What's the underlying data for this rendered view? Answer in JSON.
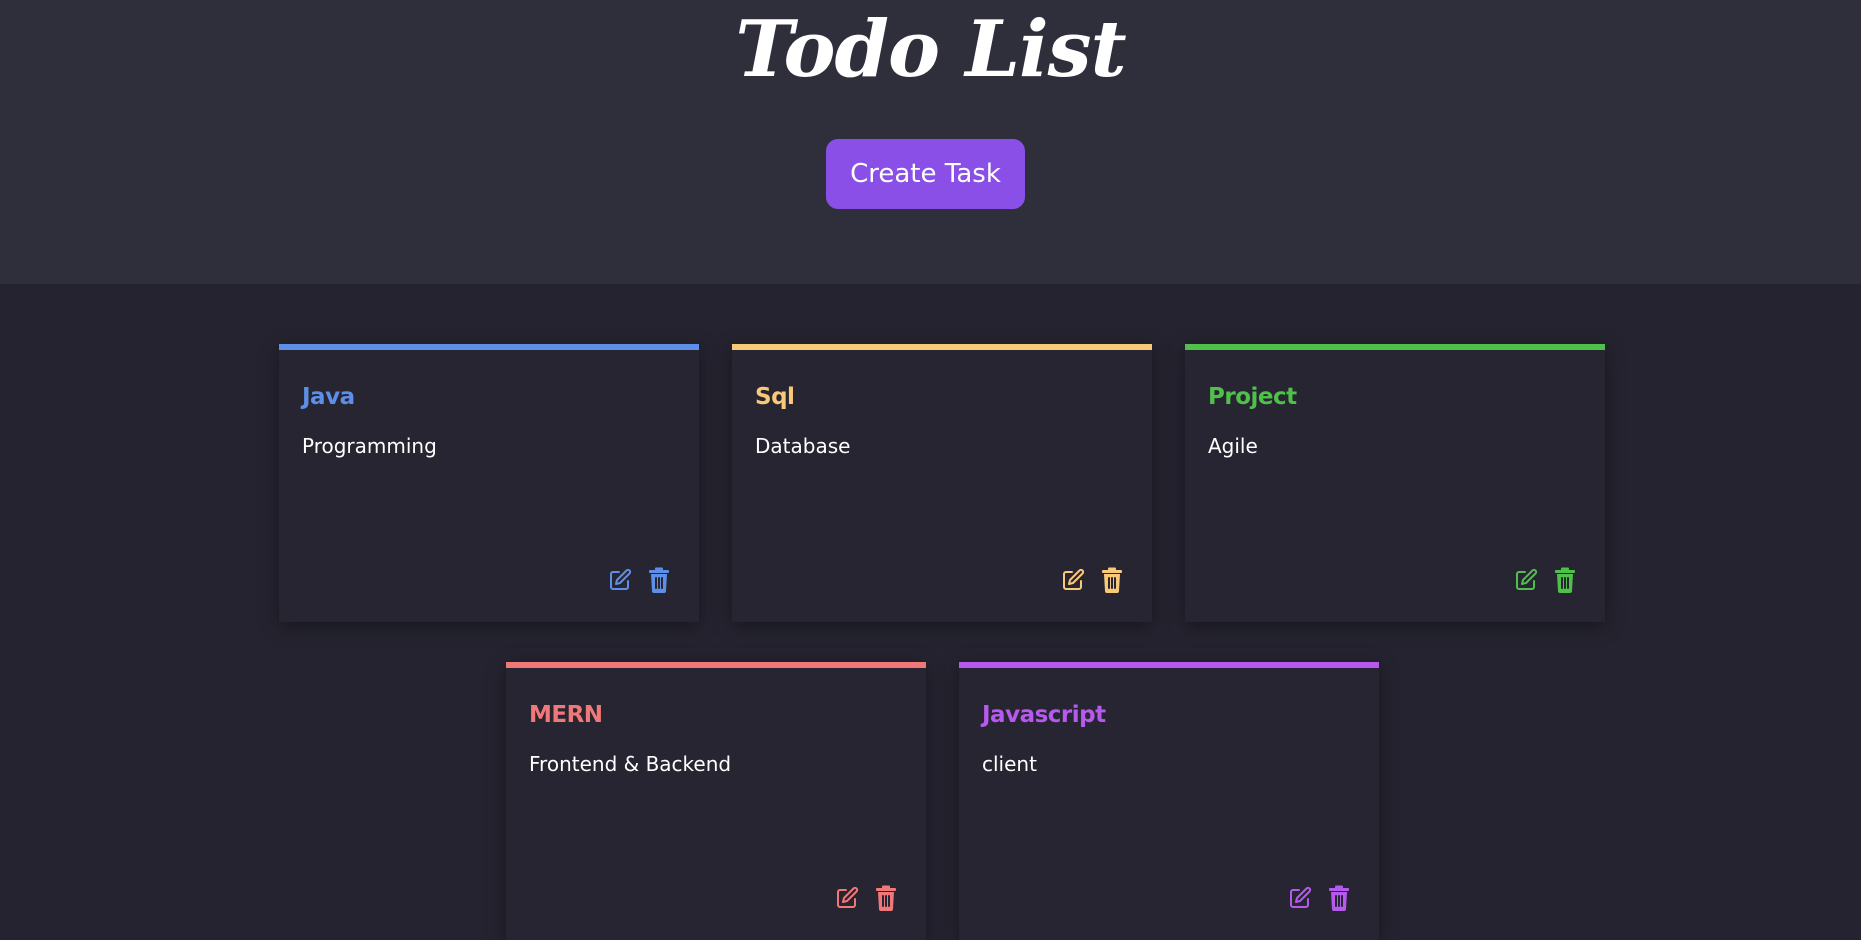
{
  "header": {
    "title": "Todo List",
    "create_button_label": "Create Task"
  },
  "colors": {
    "header_bg": "#2f2e3b",
    "page_bg": "#24232f",
    "card_bg": "#262531",
    "button_bg": "#8a4fe6"
  },
  "tasks": [
    {
      "title": "Java",
      "description": "Programming",
      "color": "#5d8ee8",
      "edit_icon": "edit-icon",
      "delete_icon": "trash-icon"
    },
    {
      "title": "Sql",
      "description": "Database",
      "color": "#f9c97a",
      "edit_icon": "edit-icon",
      "delete_icon": "trash-icon"
    },
    {
      "title": "Project",
      "description": "Agile",
      "color": "#4fc04a",
      "edit_icon": "edit-icon",
      "delete_icon": "trash-icon"
    },
    {
      "title": "MERN",
      "description": "Frontend & Backend",
      "color": "#f07878",
      "edit_icon": "edit-icon",
      "delete_icon": "trash-icon"
    },
    {
      "title": "Javascript",
      "description": "client",
      "color": "#b659ef",
      "edit_icon": "edit-icon",
      "delete_icon": "trash-icon"
    }
  ]
}
